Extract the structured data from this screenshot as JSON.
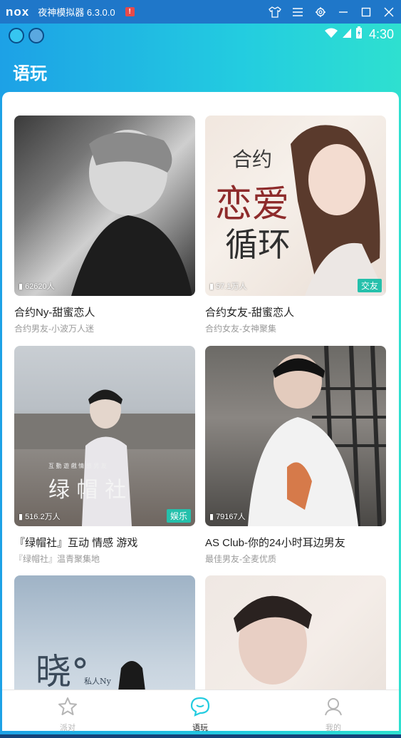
{
  "emulator": {
    "logo": "nox",
    "title": "夜神模拟器 6.3.0.0",
    "alert": "!",
    "icons": [
      "shirt-icon",
      "menu-icon",
      "settings-icon",
      "minimize-icon",
      "maximize-icon",
      "close-icon"
    ]
  },
  "status_bar": {
    "time": "4:30"
  },
  "header": {
    "title": "语玩"
  },
  "rooms": [
    {
      "title": "合约Ny-甜蜜恋人",
      "subtitle": "合约男友-小波万人迷",
      "count": "62620人",
      "tag": ""
    },
    {
      "title": "合约女友-甜蜜恋人",
      "subtitle": "合约女友-女神聚集",
      "count": "57.1万人",
      "tag": "交友",
      "overlay_text": [
        "合约",
        "恋爱",
        "循环"
      ]
    },
    {
      "title": "『绿帽社』互动 情感 游戏",
      "subtitle": "『绿帽社』温青聚集地",
      "count": "516.2万人",
      "tag": "娱乐",
      "overlay_text": [
        "互 動  遊 戲  情 感  男 友",
        "绿 帽 社"
      ]
    },
    {
      "title": "AS Club-你的24小时耳边男友",
      "subtitle": "最佳男友-全麦优质",
      "count": "79167人",
      "tag": ""
    },
    {
      "title": "",
      "subtitle": "",
      "count": "",
      "tag": "",
      "overlay_text": [
        "晓°",
        "私人Ny"
      ]
    },
    {
      "title": "",
      "subtitle": "",
      "count": "",
      "tag": ""
    }
  ],
  "bottom_nav": [
    {
      "label": "派对",
      "icon": "star-icon",
      "active": false
    },
    {
      "label": "语玩",
      "icon": "chat-bubble-icon",
      "active": true
    },
    {
      "label": "我的",
      "icon": "user-icon",
      "active": false
    }
  ],
  "colors": {
    "accent": "#23cce0",
    "tag": "#25c0ab",
    "emulator_bar": "#1f77c9"
  }
}
